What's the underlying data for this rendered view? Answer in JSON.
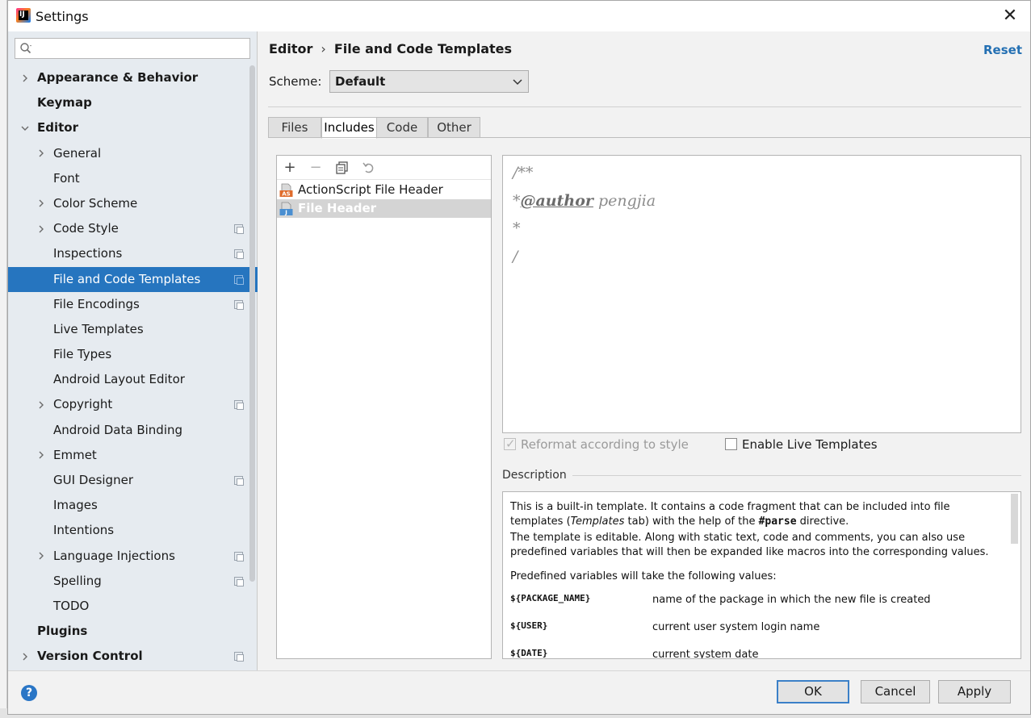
{
  "window": {
    "title": "Settings"
  },
  "sidebar": {
    "search": {
      "placeholder": "",
      "value": ""
    },
    "items": [
      {
        "label": "Appearance & Behavior",
        "level": 0,
        "arrow": "right",
        "project": false,
        "selected": false
      },
      {
        "label": "Keymap",
        "level": 0,
        "arrow": "",
        "project": false,
        "selected": false
      },
      {
        "label": "Editor",
        "level": 0,
        "arrow": "down",
        "project": false,
        "selected": false
      },
      {
        "label": "General",
        "level": 1,
        "arrow": "right",
        "project": false,
        "selected": false
      },
      {
        "label": "Font",
        "level": 1,
        "arrow": "",
        "project": false,
        "selected": false
      },
      {
        "label": "Color Scheme",
        "level": 1,
        "arrow": "right",
        "project": false,
        "selected": false
      },
      {
        "label": "Code Style",
        "level": 1,
        "arrow": "right",
        "project": true,
        "selected": false
      },
      {
        "label": "Inspections",
        "level": 1,
        "arrow": "",
        "project": true,
        "selected": false
      },
      {
        "label": "File and Code Templates",
        "level": 1,
        "arrow": "",
        "project": true,
        "selected": true
      },
      {
        "label": "File Encodings",
        "level": 1,
        "arrow": "",
        "project": true,
        "selected": false
      },
      {
        "label": "Live Templates",
        "level": 1,
        "arrow": "",
        "project": false,
        "selected": false
      },
      {
        "label": "File Types",
        "level": 1,
        "arrow": "",
        "project": false,
        "selected": false
      },
      {
        "label": "Android Layout Editor",
        "level": 1,
        "arrow": "",
        "project": false,
        "selected": false
      },
      {
        "label": "Copyright",
        "level": 1,
        "arrow": "right",
        "project": true,
        "selected": false
      },
      {
        "label": "Android Data Binding",
        "level": 1,
        "arrow": "",
        "project": false,
        "selected": false
      },
      {
        "label": "Emmet",
        "level": 1,
        "arrow": "right",
        "project": false,
        "selected": false
      },
      {
        "label": "GUI Designer",
        "level": 1,
        "arrow": "",
        "project": true,
        "selected": false
      },
      {
        "label": "Images",
        "level": 1,
        "arrow": "",
        "project": false,
        "selected": false
      },
      {
        "label": "Intentions",
        "level": 1,
        "arrow": "",
        "project": false,
        "selected": false
      },
      {
        "label": "Language Injections",
        "level": 1,
        "arrow": "right",
        "project": true,
        "selected": false
      },
      {
        "label": "Spelling",
        "level": 1,
        "arrow": "",
        "project": true,
        "selected": false
      },
      {
        "label": "TODO",
        "level": 1,
        "arrow": "",
        "project": false,
        "selected": false
      },
      {
        "label": "Plugins",
        "level": 0,
        "arrow": "",
        "project": false,
        "selected": false
      },
      {
        "label": "Version Control",
        "level": 0,
        "arrow": "right",
        "project": true,
        "selected": false
      }
    ]
  },
  "header": {
    "breadcrumb": [
      "Editor",
      "File and Code Templates"
    ],
    "breadcrumb_sep": "›",
    "reset_label": "Reset",
    "scheme_label": "Scheme:",
    "scheme_value": "Default"
  },
  "tabs": [
    {
      "label": "Files",
      "active": false
    },
    {
      "label": "Includes",
      "active": true
    },
    {
      "label": "Code",
      "active": false
    },
    {
      "label": "Other",
      "active": false
    }
  ],
  "templates": [
    {
      "name": "ActionScript File Header",
      "icon": "as-file-icon",
      "badge": "AS",
      "selected": false
    },
    {
      "name": "File Header",
      "icon": "java-file-icon",
      "badge": "J",
      "selected": true
    }
  ],
  "editor": {
    "lines": [
      {
        "text": "/**"
      },
      {
        "prefix": "*",
        "tag": "@author",
        "rest": " pengjia"
      },
      {
        "text": "*"
      },
      {
        "text": "/"
      }
    ]
  },
  "options": {
    "reformat_label": "Reformat according to style",
    "reformat_checked": true,
    "live_templates_label": "Enable Live Templates",
    "live_templates_checked": false
  },
  "description": {
    "title": "Description",
    "para1_a": "This is a built-in template. It contains a code fragment that can be included into file templates (",
    "para1_em": "Templates",
    "para1_b": " tab) with the help of the ",
    "para1_code": "#parse",
    "para1_c": " directive.",
    "para2": "The template is editable. Along with static text, code and comments, you can also use predefined variables that will then be expanded like macros into the corresponding values.",
    "para3": "Predefined variables will take the following values:",
    "variables": [
      {
        "name": "${PACKAGE_NAME}",
        "desc": "name of the package in which the new file is created"
      },
      {
        "name": "${USER}",
        "desc": "current user system login name"
      },
      {
        "name": "${DATE}",
        "desc": "current system date"
      }
    ]
  },
  "footer": {
    "help_label": "?",
    "ok_label": "OK",
    "cancel_label": "Cancel",
    "apply_label": "Apply"
  },
  "colors": {
    "selection": "#2675bf",
    "link": "#2470b3",
    "sidebar_bg": "#e6ebf0"
  }
}
